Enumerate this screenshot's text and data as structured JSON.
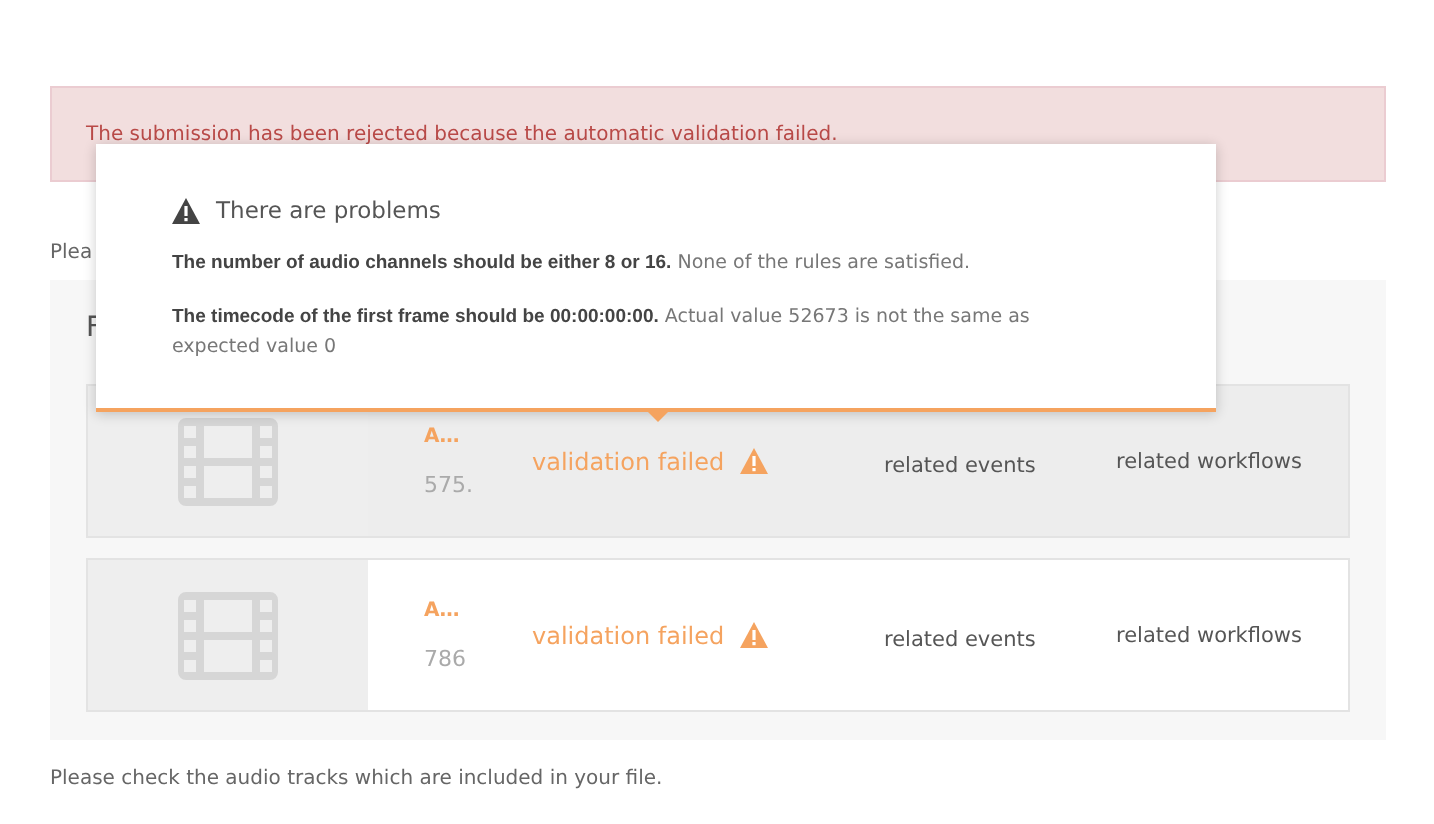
{
  "alert": {
    "text": "The submission has been rejected because the automatic validation failed."
  },
  "intro": "Plea",
  "panel": {
    "heading": "F",
    "rows": [
      {
        "name": "A…",
        "size": "575.",
        "status": "validation failed",
        "events": "related events",
        "workflows": "related workflows",
        "highlighted": true
      },
      {
        "name": "A…",
        "size": "786",
        "status": "validation failed",
        "events": "related events",
        "workflows": "related workflows",
        "highlighted": false
      }
    ]
  },
  "footer": "Please check the audio tracks which are included in your file.",
  "popover": {
    "title": "There are problems",
    "problems": [
      "**The number of audio channels should be either 8 or 16.** None of the rules are satisfied.",
      "**The timecode of the first frame should be 00:00:00:00.** Actual value 52673 is not the same as expected value 0"
    ]
  }
}
